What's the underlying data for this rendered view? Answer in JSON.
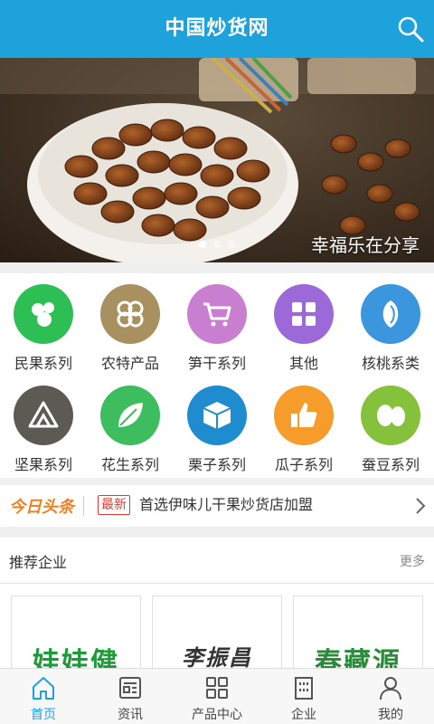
{
  "header": {
    "title": "中国炒货网",
    "search_icon": "search-icon"
  },
  "banner": {
    "caption": "幸福乐在分享",
    "slide_count": 3,
    "active_slide": 1
  },
  "categories": [
    {
      "label": "民果系列",
      "color": "#2dbf53",
      "icon": "nuts-icon"
    },
    {
      "label": "农特产品",
      "color": "#a89060",
      "icon": "clover-icon"
    },
    {
      "label": "笋干系列",
      "color": "#c87fd0",
      "icon": "cart-icon"
    },
    {
      "label": "其他",
      "color": "#9b6ad8",
      "icon": "grid-icon"
    },
    {
      "label": "核桃系类",
      "color": "#3b96de",
      "icon": "seed-icon"
    },
    {
      "label": "坚果系列",
      "color": "#5b5b54",
      "icon": "triangles-icon"
    },
    {
      "label": "花生系列",
      "color": "#3dbd5e",
      "icon": "leaf-icon"
    },
    {
      "label": "栗子系列",
      "color": "#1e8ccf",
      "icon": "box-icon"
    },
    {
      "label": "瓜子系列",
      "color": "#f59c2a",
      "icon": "thumbs-up-icon"
    },
    {
      "label": "蚕豆系列",
      "color": "#86c13b",
      "icon": "beans-icon"
    }
  ],
  "news": {
    "logo": "今日头条",
    "tag": "最新",
    "headline": "首选伊味儿干果炒货店加盟"
  },
  "recommend": {
    "title": "推荐企业",
    "more": "更多",
    "companies": [
      {
        "name": "娃娃健",
        "color": "#1f9a3a"
      },
      {
        "name": "李振昌",
        "color": "#333333"
      },
      {
        "name": "春藏源",
        "color": "#2a8a3a"
      }
    ]
  },
  "tabs": [
    {
      "label": "首页",
      "icon": "home-icon",
      "active": true
    },
    {
      "label": "资讯",
      "icon": "news-icon",
      "active": false
    },
    {
      "label": "产品中心",
      "icon": "products-grid-icon",
      "active": false
    },
    {
      "label": "企业",
      "icon": "building-icon",
      "active": false
    },
    {
      "label": "我的",
      "icon": "user-icon",
      "active": false
    }
  ],
  "colors": {
    "primary": "#1ea2dc",
    "accent": "#e53935",
    "news_logo": "#f08020"
  }
}
